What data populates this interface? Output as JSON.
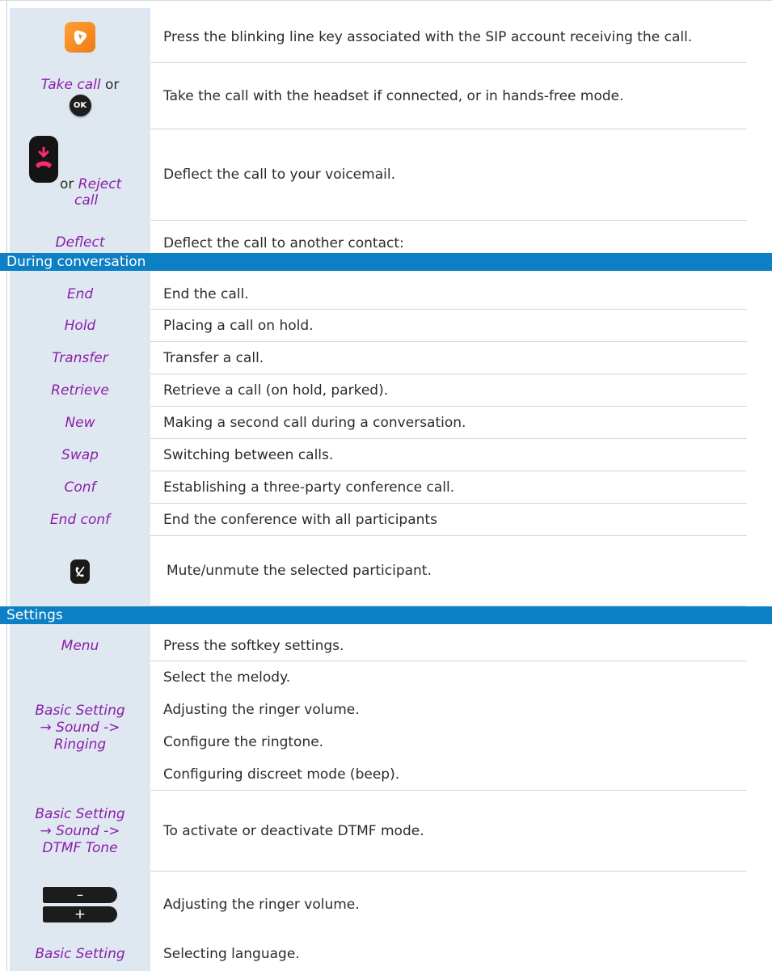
{
  "incoming": {
    "line_key_desc": "Press the blinking line key associated with the SIP account receiving the call.",
    "take_call_label": "Take call",
    "or_text": "or",
    "ok_label": "OK",
    "take_call_desc": "Take the call with the headset if connected, or in hands-free mode.",
    "reject_or_text": "or",
    "reject_label_line1": "Reject",
    "reject_label_line2": "call",
    "reject_desc": "Deflect the call to your voicemail.",
    "deflect_label": "Deflect",
    "deflect_desc": "Deflect the call to another contact:"
  },
  "conversation": {
    "header": "During conversation",
    "rows": [
      {
        "key": "End",
        "desc": "End the call."
      },
      {
        "key": "Hold",
        "desc": "Placing a call on hold."
      },
      {
        "key": "Transfer",
        "desc": "Transfer a call."
      },
      {
        "key": "Retrieve",
        "desc": "Retrieve a call (on hold, parked)."
      },
      {
        "key": "New",
        "desc": "Making a second call during a conversation."
      },
      {
        "key": "Swap",
        "desc": "Switching between calls."
      },
      {
        "key": "Conf",
        "desc": "Establishing a three-party conference call."
      },
      {
        "key": "End conf",
        "desc": "End the conference with all participants"
      }
    ],
    "mute_desc": "Mute/unmute the selected participant."
  },
  "settings": {
    "header": "Settings",
    "menu_label": "Menu",
    "menu_desc": "Press the softkey settings.",
    "ringing_label_line1": "Basic Setting",
    "ringing_label_line2": "→ Sound ->",
    "ringing_label_line3": "Ringing",
    "ringing_descs": [
      "Select the melody.",
      "Adjusting the ringer volume.",
      "Configure the ringtone.",
      "Configuring discreet mode (beep)."
    ],
    "dtmf_label_line1": "Basic Setting",
    "dtmf_label_line2": "→ Sound ->",
    "dtmf_label_line3": "DTMF Tone",
    "dtmf_desc": "To activate or deactivate DTMF mode.",
    "volume_minus": "–",
    "volume_plus": "+",
    "volume_desc": "Adjusting the ringer volume.",
    "language_label": "Basic Setting",
    "language_desc": "Selecting language."
  }
}
